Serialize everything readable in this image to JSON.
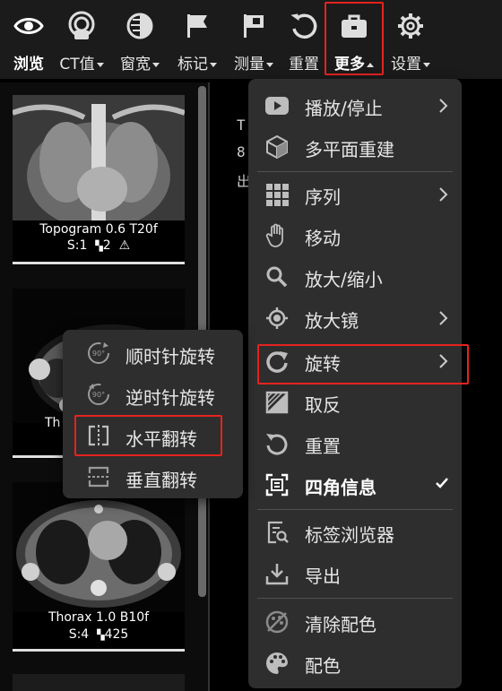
{
  "toolbar": {
    "items": [
      {
        "label": "浏览",
        "icon": "eye-icon",
        "bold": true
      },
      {
        "label": "CT值",
        "icon": "ct-value-icon",
        "dropdown": true
      },
      {
        "label": "窗宽",
        "icon": "window-level-icon",
        "dropdown": true
      },
      {
        "label": "标记",
        "icon": "flag-icon",
        "dropdown": true
      },
      {
        "label": "测量",
        "icon": "measure-flag-icon",
        "dropdown": true
      },
      {
        "label": "重置",
        "icon": "reset-icon"
      },
      {
        "label": "更多",
        "icon": "toolbox-icon",
        "dropdown": true,
        "open": true
      },
      {
        "label": "设置",
        "icon": "gear-icon",
        "dropdown": true
      }
    ]
  },
  "series": [
    {
      "name": "Topogram 0.6 T20f",
      "s_label": "S:1",
      "count": "2",
      "warning": true
    },
    {
      "name": "Th",
      "s_label": "",
      "count": "",
      "warning": false
    },
    {
      "name": "Thorax 1.0 B10f",
      "s_label": "S:4",
      "count": "425",
      "warning": false
    }
  ],
  "viewer_overlay": {
    "line1": "T",
    "line2": "8",
    "line3": "出"
  },
  "more_menu": {
    "items": [
      {
        "label": "播放/停止",
        "icon": "play-icon",
        "submenu": true
      },
      {
        "label": "多平面重建",
        "icon": "cube-icon"
      },
      {
        "label": "序列",
        "icon": "grid-icon",
        "submenu": true
      },
      {
        "label": "移动",
        "icon": "hand-icon"
      },
      {
        "label": "放大/缩小",
        "icon": "search-icon"
      },
      {
        "label": "放大镜",
        "icon": "magnifier-target-icon",
        "submenu": true
      },
      {
        "label": "旋转",
        "icon": "rotate-icon",
        "submenu": true,
        "highlighted": true
      },
      {
        "label": "取反",
        "icon": "invert-icon"
      },
      {
        "label": "重置",
        "icon": "reset-icon"
      },
      {
        "label": "四角信息",
        "icon": "corner-info-icon",
        "checked": true,
        "bold": true
      },
      {
        "label": "标签浏览器",
        "icon": "tag-browser-icon"
      },
      {
        "label": "导出",
        "icon": "export-icon"
      },
      {
        "label": "清除配色",
        "icon": "clear-palette-icon"
      },
      {
        "label": "配色",
        "icon": "palette-icon"
      }
    ]
  },
  "rotate_submenu": {
    "items": [
      {
        "label": "顺时针旋转",
        "icon": "rotate-cw-90-icon",
        "badge": "90°"
      },
      {
        "label": "逆时针旋转",
        "icon": "rotate-ccw-90-icon",
        "badge": "90°"
      },
      {
        "label": "水平翻转",
        "icon": "flip-horizontal-icon",
        "highlighted": true
      },
      {
        "label": "垂直翻转",
        "icon": "flip-vertical-icon"
      }
    ]
  },
  "colors": {
    "highlight": "#e5231f",
    "menu_bg": "#2e2e2e",
    "toolbar_bg": "#1b1b1b"
  }
}
